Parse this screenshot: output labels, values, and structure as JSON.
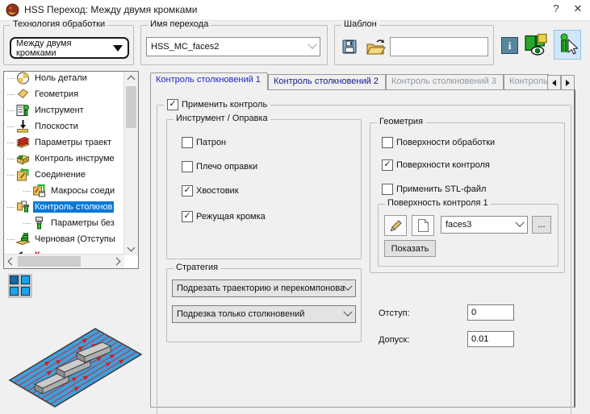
{
  "window": {
    "title": "HSS Переход: Между двумя кромками",
    "help": "?",
    "close": "✕"
  },
  "toolbar": {
    "technology": {
      "label": "Технология обработки",
      "value": "Между двумя кромками"
    },
    "transition_name": {
      "label": "Имя перехода",
      "value": "HSS_MC_faces2"
    },
    "template": {
      "label": "Шаблон",
      "value": ""
    }
  },
  "tree": {
    "items": [
      {
        "label": "Ноль детали"
      },
      {
        "label": "Геометрия"
      },
      {
        "label": "Инструмент"
      },
      {
        "label": "Плоскости"
      },
      {
        "label": "Параметры траект"
      },
      {
        "label": "Контроль инструме"
      },
      {
        "label": "Соединение"
      },
      {
        "label": "Макросы соеди"
      },
      {
        "label": "Контроль столкнов"
      },
      {
        "label": "Параметры без"
      },
      {
        "label": "Черновая (Отступы"
      },
      {
        "label": "К"
      }
    ]
  },
  "tabs": [
    {
      "label": "Контроль столкновений 1",
      "state": "active"
    },
    {
      "label": "Контроль столкновений 2",
      "state": "enabled"
    },
    {
      "label": "Контроль столкновений 3",
      "state": "disabled"
    },
    {
      "label": "Контроль с",
      "state": "disabled"
    }
  ],
  "panel": {
    "apply_control": {
      "label": "Применить контроль",
      "checked": true
    },
    "tool_holder": {
      "label": "Инструмент / Оправка",
      "items": [
        {
          "label": "Патрон",
          "checked": false
        },
        {
          "label": "Плечо оправки",
          "checked": false
        },
        {
          "label": "Хвостовик",
          "checked": true
        },
        {
          "label": "Режущая кромка",
          "checked": true
        }
      ]
    },
    "strategy": {
      "label": "Стратегия",
      "dropdown1": "Подрезать траекторию и перекомпонова",
      "dropdown2": "Подрезка только столкновений"
    },
    "geometry": {
      "label": "Геометрия",
      "items": [
        {
          "label": "Поверхности обработки",
          "checked": false
        },
        {
          "label": "Поверхности контроля",
          "checked": true
        },
        {
          "label": "Применить STL-файл",
          "checked": false
        }
      ],
      "control_surface": {
        "label": "Поверхность контроля 1",
        "combo_value": "faces3",
        "browse": "...",
        "show_button": "Показать"
      }
    },
    "offset": {
      "label": "Отступ:",
      "value": "0"
    },
    "tolerance": {
      "label": "Допуск:",
      "value": "0.01"
    }
  },
  "colors": {
    "selection": "#0078d7",
    "tab_active_text": "#2323cd",
    "tab_enabled_text": "#17178d",
    "tab_disabled_text": "#8e99a3",
    "plate_blue": "#3f9fdb",
    "toolpath_red": "#d42020"
  }
}
